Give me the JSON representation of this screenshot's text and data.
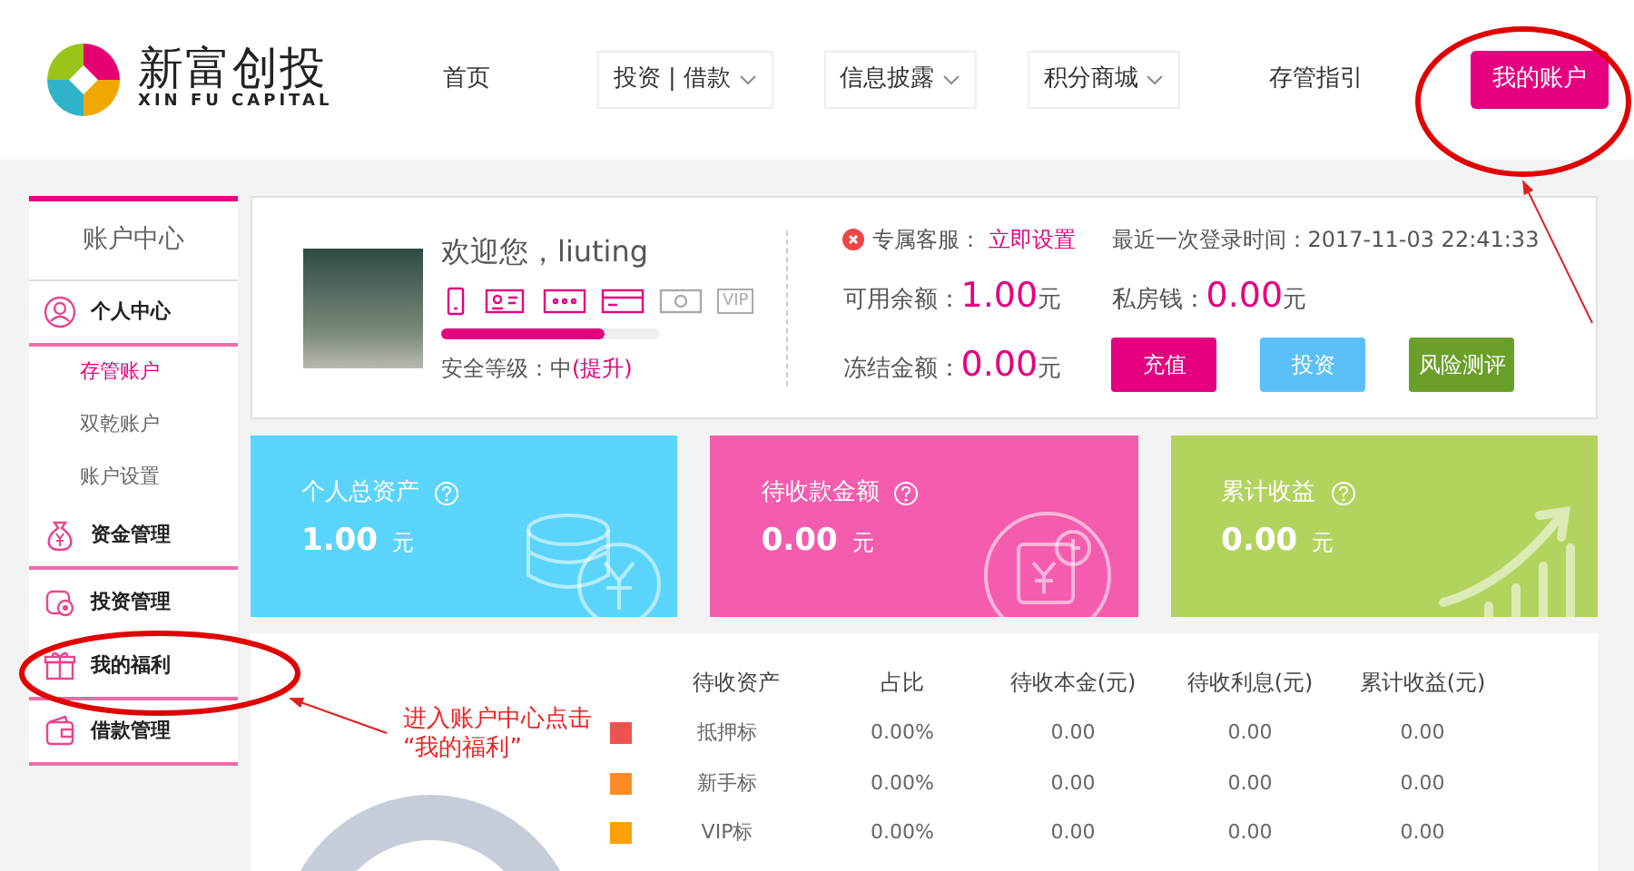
{
  "brand": {
    "name": "新富创投",
    "subtitle": "XIN FU CAPITAL"
  },
  "nav": [
    {
      "label": "首页",
      "dropdown": false
    },
    {
      "label": "投资 | 借款",
      "dropdown": true
    },
    {
      "label": "信息披露",
      "dropdown": true
    },
    {
      "label": "积分商城",
      "dropdown": true
    },
    {
      "label": "存管指引",
      "dropdown": false
    }
  ],
  "account_button": "我的账户",
  "sidebar": {
    "title": "账户中心",
    "items": [
      {
        "label": "个人中心",
        "children": [
          {
            "label": "存管账户",
            "selected": true
          },
          {
            "label": "双乾账户",
            "selected": false
          },
          {
            "label": "账户设置",
            "selected": false
          }
        ]
      },
      {
        "label": "资金管理"
      },
      {
        "label": "投资管理"
      },
      {
        "label": "我的福利"
      },
      {
        "label": "借款管理"
      }
    ]
  },
  "profile": {
    "greeting": "欢迎您，liuting",
    "badges": [
      {
        "verified": true
      },
      {
        "verified": true
      },
      {
        "verified": true
      },
      {
        "verified": true
      },
      {
        "verified": false
      },
      {
        "verified": false,
        "label": "VIP"
      }
    ],
    "security_meter": {
      "level": 0.75
    },
    "security_label": "安全等级：中",
    "security_link": "(提升)",
    "service_label": "专属客服：",
    "service_link": "立即设置",
    "last_login": "最近一次登录时间：2017-11-03 22:41:33",
    "balances": [
      {
        "label": "可用余额：",
        "amount": "1.00",
        "unit": "元"
      },
      {
        "label": "私房钱：",
        "amount": "0.00",
        "unit": "元"
      },
      {
        "label": "冻结金额：",
        "amount": "0.00",
        "unit": "元"
      }
    ],
    "buttons": [
      {
        "label": "充值",
        "color": "#e4007f"
      },
      {
        "label": "投资",
        "color": "#5bc0f8"
      },
      {
        "label": "风险测评",
        "color": "#6a9f2a"
      }
    ]
  },
  "tiles": [
    {
      "title": "个人总资产",
      "amount": "1.00",
      "unit": "元",
      "color": "#5ad4fb"
    },
    {
      "title": "待收款金额",
      "amount": "0.00",
      "unit": "元",
      "color": "#f45cae"
    },
    {
      "title": "累计收益",
      "amount": "0.00",
      "unit": "元",
      "color": "#b2d35e"
    }
  ],
  "assets_table": {
    "columns": [
      "待收资产",
      "占比",
      "待收本金(元)",
      "待收利息(元)",
      "累计收益(元)"
    ],
    "rows": [
      {
        "color": "#ef5350",
        "cells": [
          "抵押标",
          "0.00%",
          "0.00",
          "0.00",
          "0.00"
        ]
      },
      {
        "color": "#ff8a25",
        "cells": [
          "新手标",
          "0.00%",
          "0.00",
          "0.00",
          "0.00"
        ]
      },
      {
        "color": "#ff9f0a",
        "cells": [
          "VIP标",
          "0.00%",
          "0.00",
          "0.00",
          "0.00"
        ]
      }
    ]
  },
  "annotation": {
    "note": "进入账户中心点击\n“我的福利”"
  }
}
